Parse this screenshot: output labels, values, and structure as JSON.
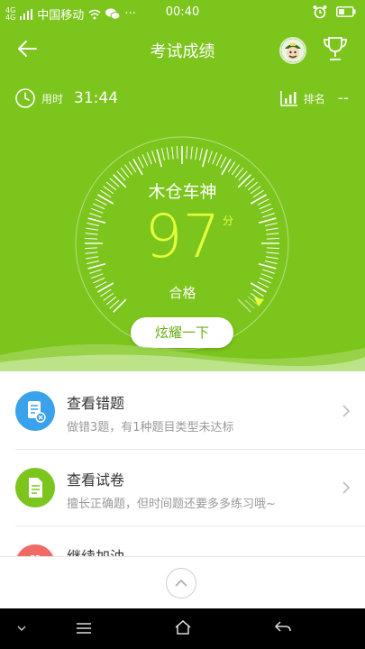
{
  "status_bar": {
    "signal_top": "4G",
    "signal_bottom": "4G",
    "carrier": "中国移动",
    "time": "00:40",
    "more": "···"
  },
  "header": {
    "title": "考试成绩"
  },
  "stats": {
    "time_label": "用时",
    "time_value": "31:44",
    "rank_label": "排名",
    "rank_value": "--"
  },
  "result": {
    "nickname": "木仓车神",
    "score": "97",
    "score_unit": "分",
    "verdict": "合格",
    "share_label": "炫耀一下"
  },
  "menu": [
    {
      "title": "查看错题",
      "subtitle": "做错3题，有1种题目类型未达标",
      "color": "#3aa2ea",
      "icon": "wrong-questions-icon"
    },
    {
      "title": "查看试卷",
      "subtitle": "擅长正确题，但时间题还要多多练习哦~",
      "color": "#7cc51c",
      "icon": "exam-paper-icon"
    },
    {
      "title": "继续加油",
      "subtitle": "",
      "color": "#f06a66",
      "icon": "gift-icon"
    }
  ],
  "colors": {
    "primary": "#7cc51c",
    "score": "#e3ff3d",
    "blue": "#3aa2ea",
    "red": "#f06a66"
  }
}
